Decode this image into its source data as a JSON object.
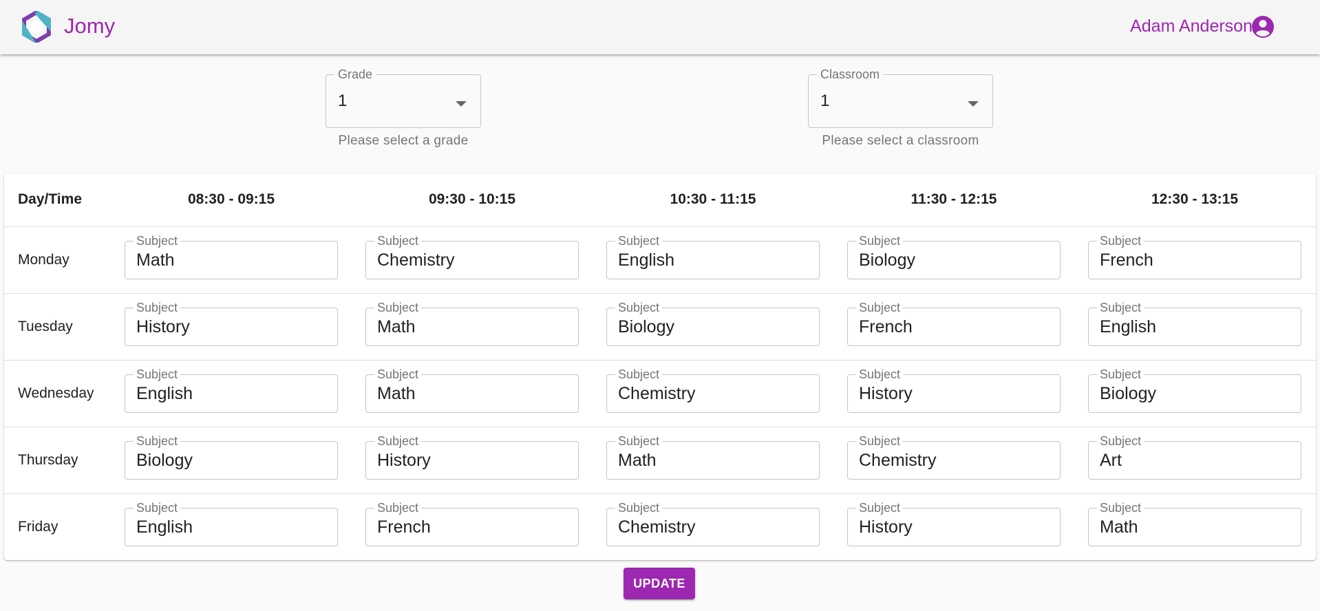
{
  "app": {
    "brand": "Jomy",
    "user_name": "Adam Anderson",
    "accent_color": "#9c27b0"
  },
  "filters": {
    "grade": {
      "label": "Grade",
      "value": "1",
      "helper": "Please select a grade"
    },
    "classroom": {
      "label": "Classroom",
      "value": "1",
      "helper": "Please select a classroom"
    }
  },
  "schedule": {
    "corner_header": "Day/Time",
    "times": [
      "08:30 - 09:15",
      "09:30 - 10:15",
      "10:30 - 11:15",
      "11:30 - 12:15",
      "12:30 - 13:15"
    ],
    "field_label": "Subject",
    "rows": [
      {
        "day": "Monday",
        "subjects": [
          "Math",
          "Chemistry",
          "English",
          "Biology",
          "French"
        ]
      },
      {
        "day": "Tuesday",
        "subjects": [
          "History",
          "Math",
          "Biology",
          "French",
          "English"
        ]
      },
      {
        "day": "Wednesday",
        "subjects": [
          "English",
          "Math",
          "Chemistry",
          "History",
          "Biology"
        ]
      },
      {
        "day": "Thursday",
        "subjects": [
          "Biology",
          "History",
          "Math",
          "Chemistry",
          "Art"
        ]
      },
      {
        "day": "Friday",
        "subjects": [
          "English",
          "French",
          "Chemistry",
          "History",
          "Math"
        ]
      }
    ]
  },
  "actions": {
    "update_label": "UPDATE"
  }
}
